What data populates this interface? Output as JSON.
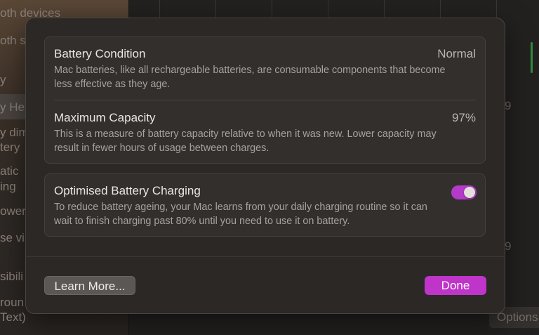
{
  "background": {
    "sidebar_fragments": [
      "oth devices",
      "oth s",
      "y",
      "y He",
      "y dim",
      "tery",
      "atic",
      "ing",
      "ower",
      "se vi",
      "sibili",
      "roun",
      " Text)"
    ],
    "right_fragments": [
      "9",
      "9"
    ],
    "options_label": "Options"
  },
  "dialog": {
    "battery_condition": {
      "title": "Battery Condition",
      "value": "Normal",
      "description": "Mac batteries, like all rechargeable batteries, are consumable components that become less effective as they age."
    },
    "maximum_capacity": {
      "title": "Maximum Capacity",
      "value": "97%",
      "description": "This is a measure of battery capacity relative to when it was new. Lower capacity may result in fewer hours of usage between charges."
    },
    "optimised_charging": {
      "title": "Optimised Battery Charging",
      "description": "To reduce battery ageing, your Mac learns from your daily charging routine so it can wait to finish charging past 80% until you need to use it on battery.",
      "enabled": true
    },
    "buttons": {
      "learn_more": "Learn More...",
      "done": "Done"
    }
  },
  "colors": {
    "accent": "#bf34c9",
    "toggle_on": "#b43bc9",
    "sheet_bg": "#2b2826"
  }
}
